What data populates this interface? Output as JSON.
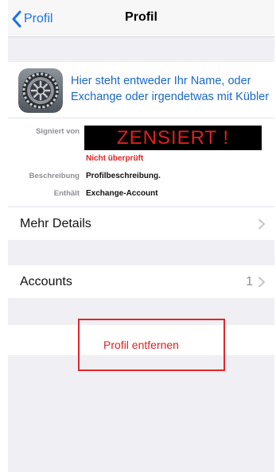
{
  "nav": {
    "back_label": "Profil",
    "title": "Profil"
  },
  "profile": {
    "icon": "settings-gear-icon",
    "name": "Hier steht entweder Ihr Name, oder Exchange oder irgendetwas mit Kübler",
    "signed_by_label": "Signiert von",
    "signed_by_value": "ZENSIERT !",
    "verification_status": "Nicht überprüft",
    "description_label": "Beschreibung",
    "description_value": "Profilbeschreibung.",
    "contains_label": "Enthält",
    "contains_value": "Exchange-Account"
  },
  "rows": {
    "more_details": {
      "label": "Mehr Details"
    },
    "accounts": {
      "label": "Accounts",
      "count": "1"
    }
  },
  "actions": {
    "remove_label": "Profil entfernen"
  },
  "colors": {
    "accent": "#1a73e8",
    "destructive": "#e02020",
    "censor_bg": "#000000",
    "annotation": "#e2262c"
  }
}
